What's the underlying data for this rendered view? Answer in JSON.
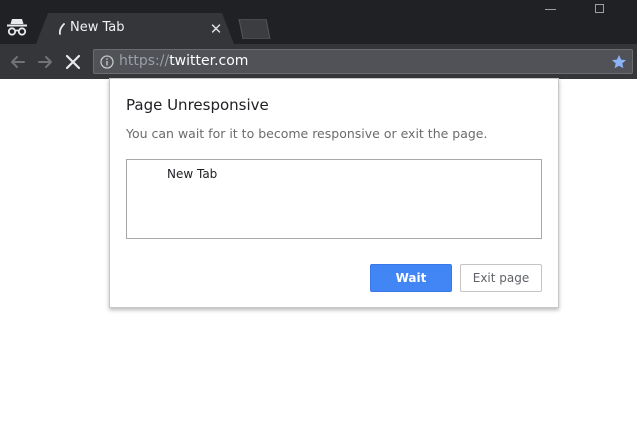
{
  "browser": {
    "tab": {
      "title": "New Tab"
    },
    "omnibox": {
      "scheme": "https://",
      "host": "twitter.com"
    },
    "icons": {
      "incognito": "incognito-icon",
      "back": "back-arrow-icon",
      "forward": "forward-arrow-icon",
      "stop": "stop-icon",
      "info": "info-icon",
      "bookmark": "star-icon",
      "close_tab": "close-icon"
    },
    "colors": {
      "accent": "#4285f4",
      "frame": "#202124",
      "toolbar": "#35363a"
    }
  },
  "dialog": {
    "title": "Page Unresponsive",
    "message": "You can wait for it to become responsive or exit the page.",
    "tab_list": [
      "New Tab"
    ],
    "buttons": {
      "wait": "Wait",
      "exit": "Exit page"
    }
  }
}
